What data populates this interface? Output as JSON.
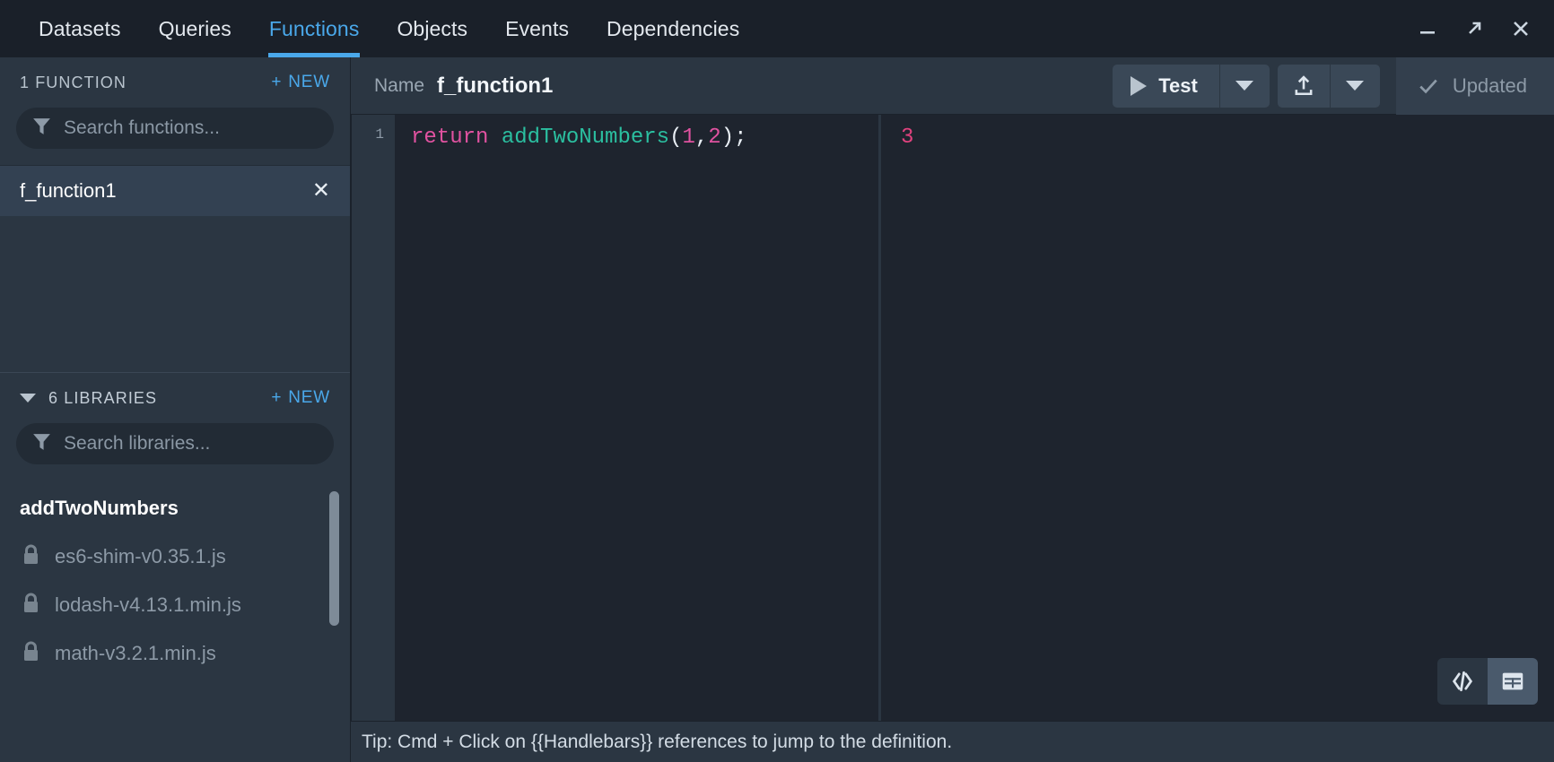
{
  "window": {
    "controls": [
      {
        "name": "minimize-button",
        "icon": "minimize-icon"
      },
      {
        "name": "maximize-button",
        "icon": "expand-arrow-icon"
      },
      {
        "name": "close-button",
        "icon": "close-icon"
      }
    ]
  },
  "nav": {
    "tabs": [
      {
        "label": "Datasets",
        "active": false
      },
      {
        "label": "Queries",
        "active": false
      },
      {
        "label": "Functions",
        "active": true
      },
      {
        "label": "Objects",
        "active": false
      },
      {
        "label": "Events",
        "active": false
      },
      {
        "label": "Dependencies",
        "active": false
      }
    ],
    "active_color": "#4aa8ea"
  },
  "sidebar": {
    "functions_section": {
      "title": "1 FUNCTION",
      "new_label": "NEW",
      "new_plus": "+",
      "search_placeholder": "Search functions...",
      "search_value": "",
      "items": [
        {
          "label": "f_function1",
          "selected": true,
          "close": "✕"
        }
      ]
    },
    "libraries_section": {
      "title": "6 LIBRARIES",
      "new_label": "NEW",
      "new_plus": "+",
      "search_placeholder": "Search libraries...",
      "search_value": "",
      "items": [
        {
          "label": "addTwoNumbers",
          "locked": false
        },
        {
          "label": "es6-shim-v0.35.1.js",
          "locked": true
        },
        {
          "label": "lodash-v4.13.1.min.js",
          "locked": true
        },
        {
          "label": "math-v3.2.1.min.js",
          "locked": true
        }
      ]
    }
  },
  "main": {
    "name_label": "Name",
    "name_value": "f_function1",
    "toolbar": {
      "test_label": "Test",
      "test_dropdown_icon": "chevron-down-icon",
      "export_icon": "upload-icon",
      "export_dropdown_icon": "chevron-down-icon",
      "status_label": "Updated",
      "status_icon": "check-icon"
    },
    "editor": {
      "line_number": "1",
      "code_tokens": [
        {
          "text": "return",
          "type": "kw"
        },
        {
          "text": " ",
          "type": "punc"
        },
        {
          "text": "addTwoNumbers",
          "type": "fn"
        },
        {
          "text": "(",
          "type": "punc"
        },
        {
          "text": "1",
          "type": "num"
        },
        {
          "text": ",",
          "type": "punc"
        },
        {
          "text": "2",
          "type": "num"
        },
        {
          "text": ")",
          "type": "punc"
        },
        {
          "text": ";",
          "type": "punc"
        }
      ],
      "code_plain": "return addTwoNumbers(1,2);"
    },
    "output": {
      "value": "3",
      "view_toggles": [
        {
          "name": "code-view-toggle",
          "icon": "code-brackets-icon",
          "active": false
        },
        {
          "name": "table-view-toggle",
          "icon": "table-grid-icon",
          "active": true
        }
      ]
    },
    "tip": "Tip: Cmd + Click on {{Handlebars}} references to jump to the definition."
  },
  "colors": {
    "accent": "#4aa8ea",
    "sidebar_bg": "#2b3642",
    "editor_bg": "#1e242e",
    "keyword": "#e052a0",
    "function": "#2bbfa0",
    "output": "#e0427e"
  }
}
